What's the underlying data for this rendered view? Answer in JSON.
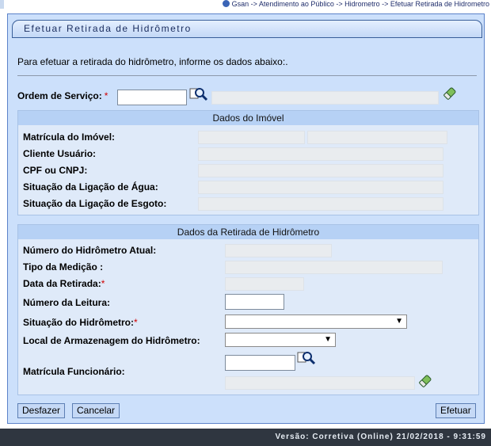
{
  "breadcrumb": {
    "text": "Gsan -> Atendimento ao Público -> Hidrometro -> Efetuar Retirada de Hidrometro"
  },
  "panel": {
    "title": "Efetuar Retirada de Hidrômetro",
    "intro": "Para efetuar a retirada do hidrômetro, informe os dados abaixo:."
  },
  "ordem_servico": {
    "label": "Ordem de Serviço:",
    "required": "*",
    "value": "",
    "description": ""
  },
  "dados_imovel": {
    "title": "Dados do Imóvel",
    "matricula_label": "Matrícula do Imóvel:",
    "cliente_label": "Cliente Usuário:",
    "cpf_label": "CPF ou CNPJ:",
    "sit_agua_label": "Situação da Ligação de Água:",
    "sit_esgoto_label": "Situação da Ligação de Esgoto:"
  },
  "dados_retirada": {
    "title": "Dados da Retirada de Hidrômetro",
    "numero_label": "Número do Hidrômetro Atual:",
    "tipo_label": "Tipo da Medição :",
    "data_label": "Data da Retirada:",
    "data_required": "*",
    "leitura_label": "Número da Leitura:",
    "situacao_label": "Situação do Hidrômetro:",
    "situacao_required": "*",
    "situacao_value": "",
    "local_label": "Local de Armazenagem do Hidrômetro:",
    "local_value": "",
    "funcionario_label": "Matrícula Funcionário:"
  },
  "buttons": {
    "desfazer": "Desfazer",
    "cancelar": "Cancelar",
    "efetuar": "Efetuar"
  },
  "footer": {
    "version": "Versão: Corretiva (Online) 21/02/2018 - 9:31:59"
  },
  "icons": {
    "search": "magnifier-search-icon",
    "eraser": "eraser-icon",
    "dropdown": "chevron-down-icon"
  },
  "colors": {
    "panel_bg": "#cce0fb",
    "section_head": "#b6d1f5",
    "required": "#d00000",
    "footer_bg": "#2f3640"
  }
}
